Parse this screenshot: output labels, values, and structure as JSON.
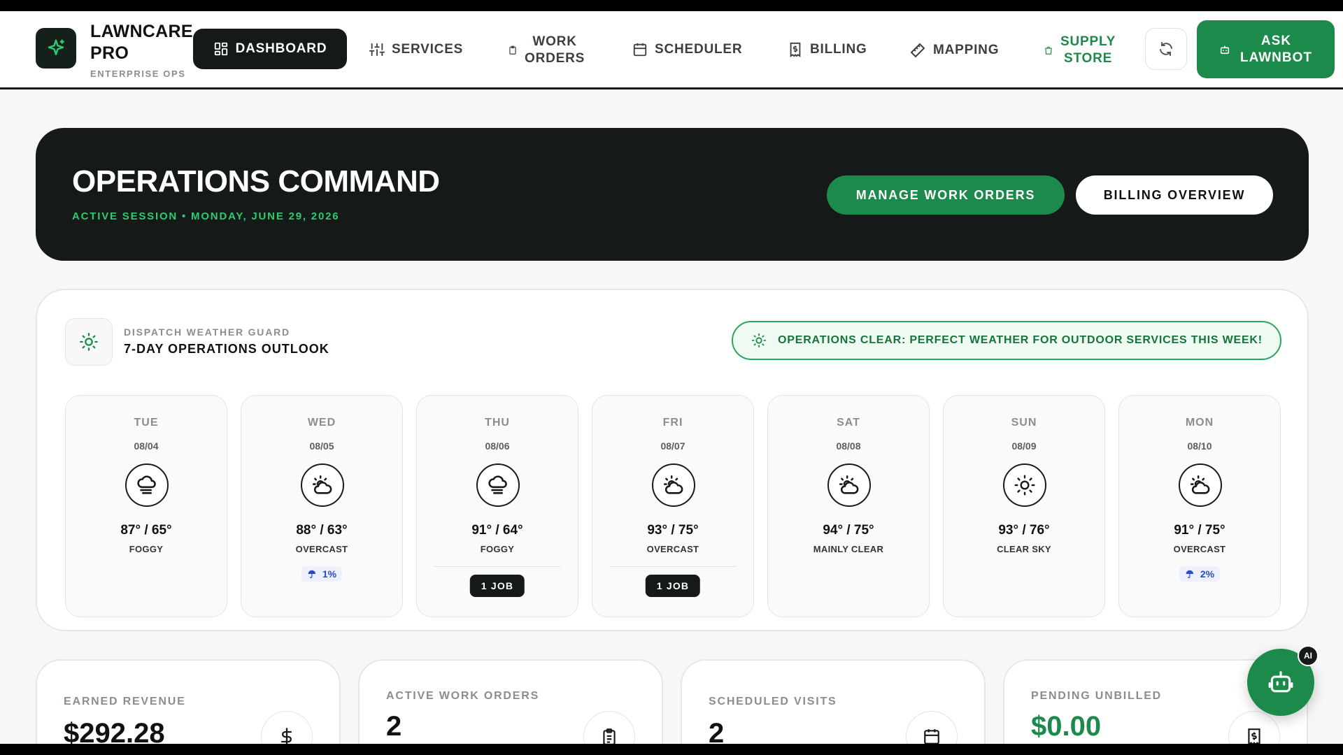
{
  "brand": {
    "title_line1": "LAWNCARE",
    "title_line2": "PRO",
    "subtitle": "ENTERPRISE OPS",
    "logo_icon": "sparkle-icon"
  },
  "nav": {
    "dashboard": "DASHBOARD",
    "services": "SERVICES",
    "work_orders_1": "WORK",
    "work_orders_2": "ORDERS",
    "scheduler": "SCHEDULER",
    "billing": "BILLING",
    "mapping": "MAPPING",
    "supply_1": "SUPPLY",
    "supply_2": "STORE",
    "ask_1": "ASK",
    "ask_2": "LAWNBOT"
  },
  "hero": {
    "title": "OPERATIONS COMMAND",
    "subtitle": "ACTIVE SESSION • MONDAY, JUNE 29, 2026",
    "manage_button": "MANAGE WORK ORDERS",
    "billing_button": "BILLING OVERVIEW"
  },
  "weather": {
    "label": "DISPATCH WEATHER GUARD",
    "title": "7-DAY OPERATIONS OUTLOOK",
    "status": "OPERATIONS CLEAR: PERFECT WEATHER FOR OUTDOOR SERVICES THIS WEEK!",
    "days": [
      {
        "name": "TUE",
        "date": "08/04",
        "temp": "87° / 65°",
        "cond": "FOGGY",
        "icon": "fog-cloud-icon"
      },
      {
        "name": "WED",
        "date": "08/05",
        "temp": "88° / 63°",
        "cond": "OVERCAST",
        "icon": "sun-cloud-icon",
        "rain": "1%"
      },
      {
        "name": "THU",
        "date": "08/06",
        "temp": "91° / 64°",
        "cond": "FOGGY",
        "icon": "fog-cloud-icon",
        "job": "1 JOB"
      },
      {
        "name": "FRI",
        "date": "08/07",
        "temp": "93° / 75°",
        "cond": "OVERCAST",
        "icon": "sun-cloud-icon",
        "job": "1 JOB"
      },
      {
        "name": "SAT",
        "date": "08/08",
        "temp": "94° / 75°",
        "cond": "MAINLY CLEAR",
        "icon": "sun-cloud-icon"
      },
      {
        "name": "SUN",
        "date": "08/09",
        "temp": "93° / 76°",
        "cond": "CLEAR SKY",
        "icon": "sun-icon"
      },
      {
        "name": "MON",
        "date": "08/10",
        "temp": "91° / 75°",
        "cond": "OVERCAST",
        "icon": "sun-cloud-icon",
        "rain": "2%"
      }
    ]
  },
  "stats": [
    {
      "label": "EARNED REVENUE",
      "value": "$292.28",
      "icon": "dollar-icon"
    },
    {
      "label": "ACTIVE WORK ORDERS",
      "value": "2",
      "icon": "clipboard-icon"
    },
    {
      "label": "SCHEDULED VISITS",
      "value": "2",
      "icon": "calendar-icon"
    },
    {
      "label": "PENDING UNBILLED",
      "value": "$0.00",
      "icon": "receipt-icon"
    }
  ],
  "fab": {
    "badge": "AI",
    "icon": "robot-icon"
  },
  "colors": {
    "accent": "#1b8a4a",
    "dark": "#151918",
    "rain": "#2b4bc4"
  }
}
